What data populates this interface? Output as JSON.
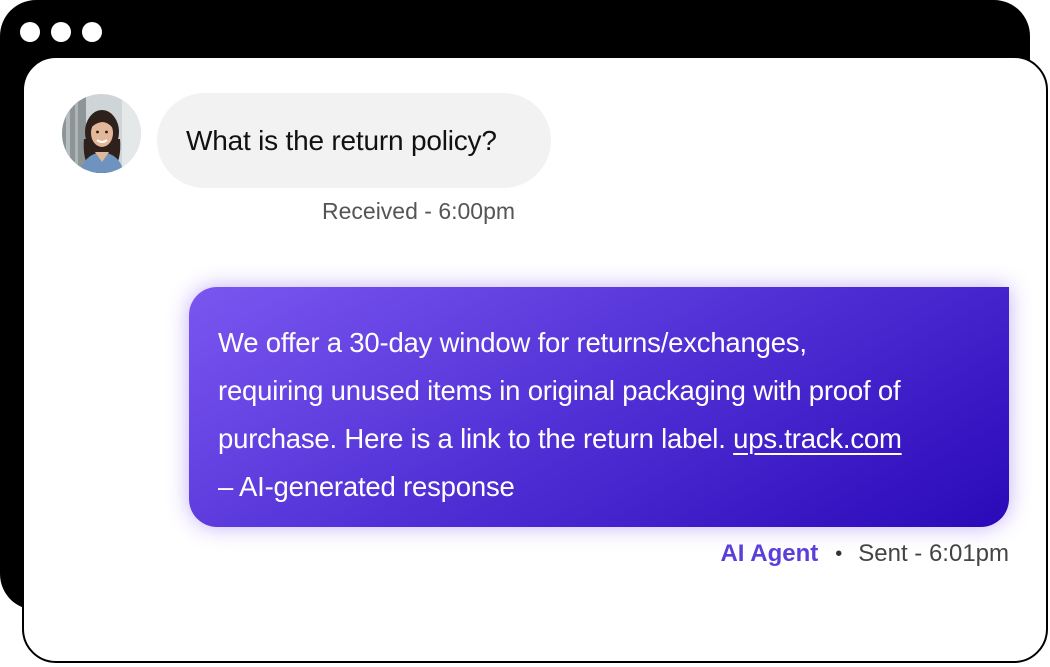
{
  "incoming": {
    "message": "What is the return policy?",
    "meta": "Received - 6:00pm",
    "avatar_icon": "user-avatar-photo"
  },
  "outgoing": {
    "line1": "We offer a 30-day window for returns/exchanges,",
    "line2": "requiring unused items in original packaging with proof of",
    "line3_prefix": "purchase. Here is a link to the return label.",
    "link_text": "ups.track.com",
    "line4": "– AI-generated response",
    "agent_name": "AI Agent",
    "separator": "•",
    "meta": "Sent - 6:01pm"
  },
  "colors": {
    "bubble_gradient_start": "#7b56f0",
    "bubble_gradient_end": "#2a09b8",
    "agent_name": "#5b3fd9",
    "incoming_bubble": "#f2f2f2"
  }
}
